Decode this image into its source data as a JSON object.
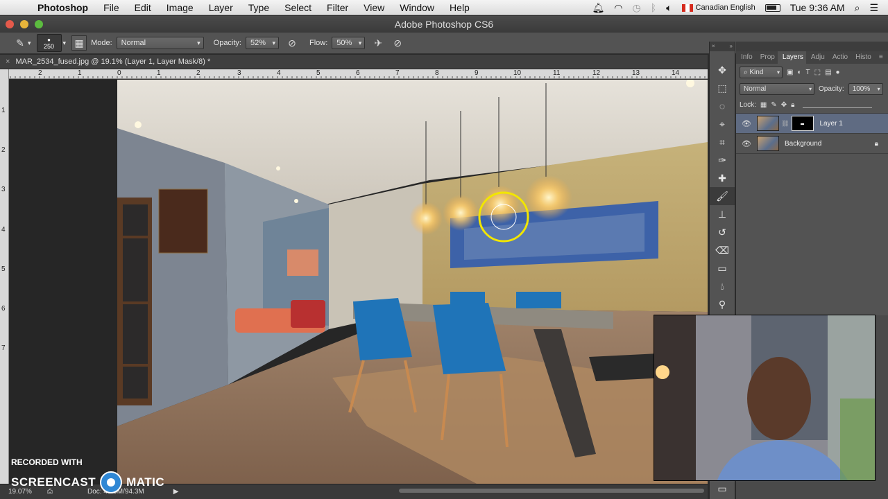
{
  "menubar": {
    "app": "Photoshop",
    "items": [
      "File",
      "Edit",
      "Image",
      "Layer",
      "Type",
      "Select",
      "Filter",
      "View",
      "Window",
      "Help"
    ],
    "input_source": "Canadian English",
    "clock": "Tue 9:36 AM"
  },
  "window": {
    "title": "Adobe Photoshop CS6"
  },
  "options": {
    "brush_size": "250",
    "mode_label": "Mode:",
    "mode_value": "Normal",
    "opacity_label": "Opacity:",
    "opacity_value": "52%",
    "flow_label": "Flow:",
    "flow_value": "50%"
  },
  "document": {
    "tab_title": "MAR_2534_fused.jpg @ 19.1% (Layer 1, Layer Mask/8) *"
  },
  "ruler": {
    "top": [
      "2",
      "1",
      "0",
      "1",
      "2",
      "3",
      "4",
      "5",
      "6",
      "7",
      "8",
      "9",
      "10",
      "11",
      "12",
      "13",
      "14"
    ],
    "left": [
      "1",
      "2",
      "3",
      "4",
      "5",
      "6",
      "7"
    ]
  },
  "status": {
    "zoom": "19.07%",
    "doc": "Doc: 48.9M/94.3M"
  },
  "layers_panel": {
    "tabs": [
      "Info",
      "Prop",
      "Layers",
      "Adju",
      "Actio",
      "Histo"
    ],
    "active_tab": "Layers",
    "kind": "Kind",
    "blend_mode": "Normal",
    "opacity_label": "Opacity:",
    "opacity_value": "100%",
    "lock_label": "Lock:",
    "layers": [
      {
        "name": "Layer 1",
        "selected": true,
        "has_mask": true
      },
      {
        "name": "Background",
        "selected": false,
        "locked": true
      }
    ]
  },
  "watermark": {
    "line1": "RECORDED WITH",
    "line2a": "SCREENCAST",
    "line2b": "MATIC"
  },
  "colors": {
    "accent_selected_layer": "#5f6b82",
    "brush_cursor": "#f2e600"
  }
}
